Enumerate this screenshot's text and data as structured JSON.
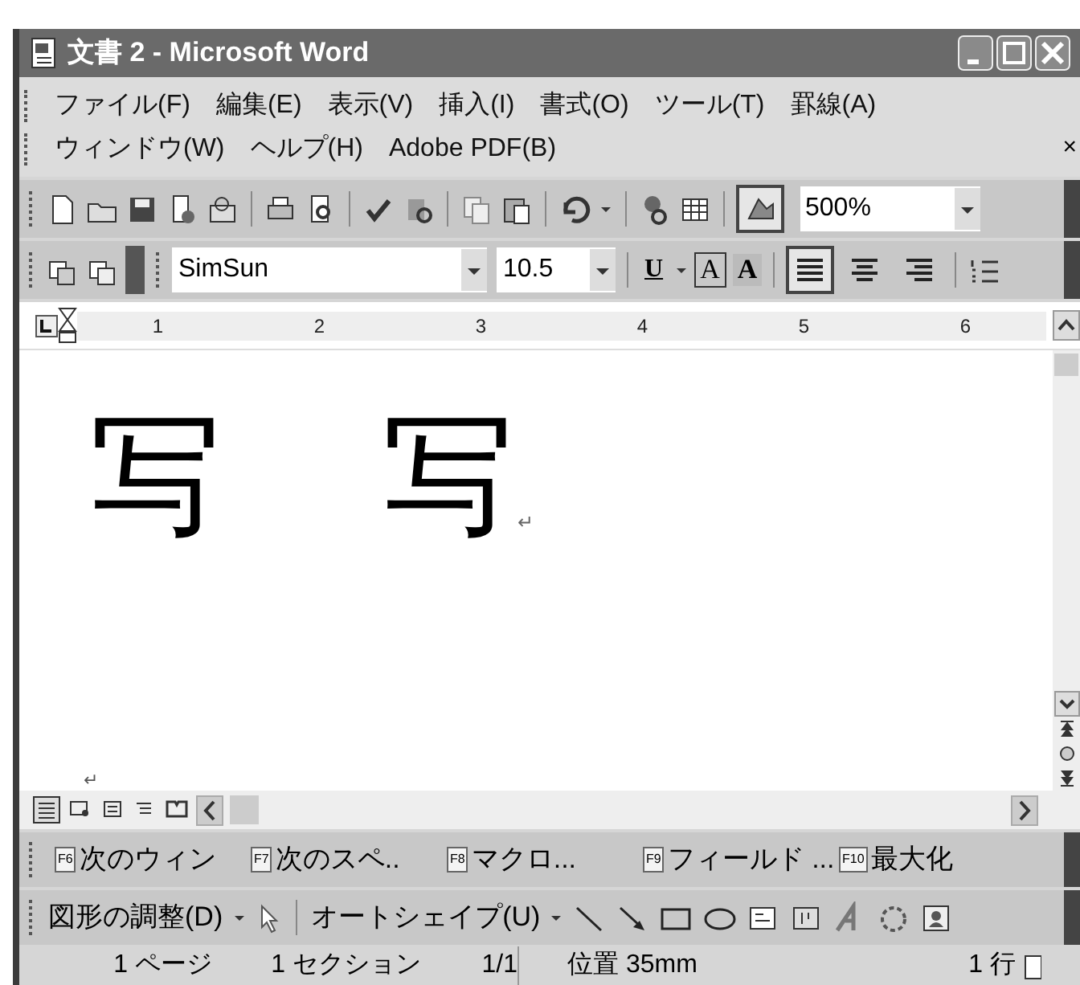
{
  "window": {
    "title": "文書 2 - Microsoft Word"
  },
  "menu_rows": [
    [
      "ファイル(F)",
      "編集(E)",
      "表示(V)",
      "挿入(I)",
      "書式(O)",
      "ツール(T)",
      "罫線(A)"
    ],
    [
      "ウィンドウ(W)",
      "ヘルプ(H)",
      "Adobe PDF(B)"
    ]
  ],
  "menu_close": "×",
  "standard_toolbar": {
    "drawing_toggle_on": true,
    "zoom": "500%"
  },
  "formatting_toolbar": {
    "font": "SimSun",
    "size": "10.5",
    "underline": "U",
    "border_char": "A",
    "shade_char": "A",
    "alignments": [
      {
        "kind": "justify",
        "selected": true
      },
      {
        "kind": "center",
        "selected": false
      },
      {
        "kind": "right",
        "selected": false
      }
    ]
  },
  "ruler": {
    "numbers": [
      "1",
      "2",
      "3",
      "4",
      "5",
      "6"
    ]
  },
  "document": {
    "glyphs": [
      "写",
      "写"
    ],
    "mark": "↵",
    "lower_mark": "↵"
  },
  "function_keys": [
    {
      "key": "F6",
      "label": "次のウィン"
    },
    {
      "key": "F7",
      "label": "次のスペ.."
    },
    {
      "key": "F8",
      "label": "マクロ..."
    },
    {
      "key": "F9",
      "label": "フィールド ..."
    },
    {
      "key": "F10",
      "label": "最大化"
    }
  ],
  "drawing_toolbar": {
    "draw_menu": "図形の調整(D)",
    "autoshapes": "オートシェイプ(U)"
  },
  "status_bar": [
    "1 ページ",
    "1 セクション",
    "1/1",
    "位置 35mm",
    "1 行"
  ]
}
